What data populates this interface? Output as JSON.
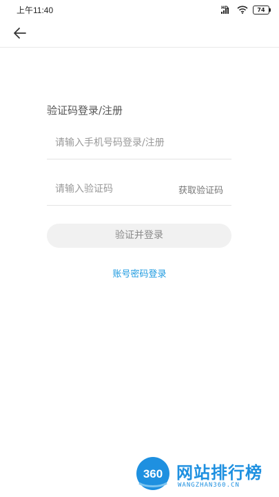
{
  "status_bar": {
    "time": "上午11:40",
    "network": "HD",
    "battery": "74"
  },
  "nav": {
    "back_icon": "arrow-left-icon"
  },
  "login": {
    "title": "验证码登录/注册",
    "phone_placeholder": "请输入手机号码登录/注册",
    "phone_value": "",
    "code_placeholder": "请输入验证码",
    "code_value": "",
    "get_code_label": "获取验证码",
    "submit_label": "验证并登录",
    "alt_login_label": "账号密码登录"
  },
  "watermark": {
    "logo_text": "360",
    "name": "网站排行榜",
    "sub": "WANGZHAN360.CN"
  },
  "colors": {
    "link": "#1f9be0",
    "button_bg": "#f1f1f1",
    "watermark": "#1e90e0"
  }
}
